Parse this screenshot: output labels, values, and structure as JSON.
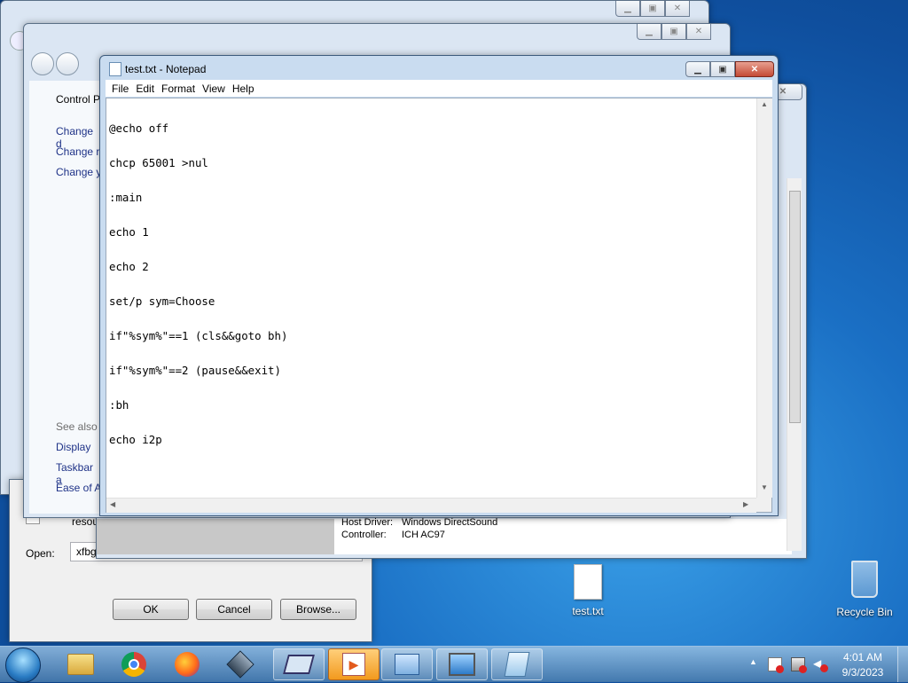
{
  "control_panel": {
    "title_left": "Control P",
    "links": [
      "Change d",
      "Change r",
      "Change y"
    ],
    "see_also": {
      "title": "See also",
      "items": [
        "Display",
        "Taskbar a",
        "Ease of A"
      ]
    }
  },
  "run_dialog": {
    "resource_text": "resou",
    "open_label": "Open:",
    "open_value": "xfbg",
    "ok": "OK",
    "cancel": "Cancel",
    "browse": "Browse..."
  },
  "dxdiag": {
    "host_driver_label": "Host Driver:",
    "host_driver_value": "Windows DirectSound",
    "controller_label": "Controller:",
    "controller_value": "ICH AC97"
  },
  "notepad": {
    "title": "test.txt - Notepad",
    "menu": [
      "File",
      "Edit",
      "Format",
      "View",
      "Help"
    ],
    "lines": [
      "@echo off",
      "chcp 65001 >nul",
      ":main",
      "echo 1",
      "echo 2",
      "set/p sym=Choose",
      "if\"%sym%\"==1 (cls&&goto bh)",
      "if\"%sym%\"==2 (pause&&exit)",
      ":bh",
      "echo i2p"
    ]
  },
  "desktop": {
    "file_icon_label": "test.txt",
    "recycle_bin_label": "Recycle Bin"
  },
  "taskbar": {
    "apps": [
      "start-orb",
      "explorer",
      "chrome",
      "firefox",
      "virtualbox",
      "run",
      "media-player",
      "control-panel",
      "dxdiag",
      "notepad"
    ],
    "clock_time": "4:01 AM",
    "clock_date": "9/3/2023"
  },
  "colors": {
    "accent": "#f29a1e",
    "desktop": "#1a6fc4",
    "close_red": "#c44a35"
  }
}
